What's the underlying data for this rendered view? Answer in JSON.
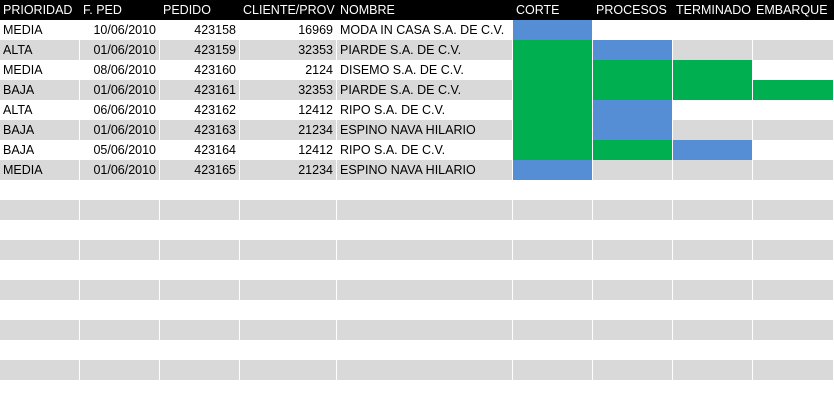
{
  "colors": {
    "header_bg": "#000000",
    "header_text": "#ffffff",
    "row_white": "#ffffff",
    "row_gray": "#d9d9d9",
    "in_progress_blue": "#558ed5",
    "done_green": "#00b050"
  },
  "headers": [
    "PRIORIDAD",
    "F. PED",
    "PEDIDO",
    "CLIENTE/PROV",
    "NOMBRE",
    "CORTE",
    "PROCESOS",
    "TERMINADO",
    "EMBARQUE"
  ],
  "orders": [
    {
      "prioridad": "MEDIA",
      "fecha": "10/06/2010",
      "pedido": "423158",
      "cliente": "16969",
      "nombre": "MODA IN CASA S.A. DE C.V.",
      "stages": [
        "blue",
        "none",
        "none",
        "none"
      ]
    },
    {
      "prioridad": "ALTA",
      "fecha": "01/06/2010",
      "pedido": "423159",
      "cliente": "32353",
      "nombre": "PIARDE S.A. DE C.V.",
      "stages": [
        "green",
        "blue",
        "none",
        "none"
      ]
    },
    {
      "prioridad": "MEDIA",
      "fecha": "08/06/2010",
      "pedido": "423160",
      "cliente": "2124",
      "nombre": "DISEMO S.A. DE C.V.",
      "stages": [
        "green",
        "green",
        "green",
        "none"
      ]
    },
    {
      "prioridad": "BAJA",
      "fecha": "01/06/2010",
      "pedido": "423161",
      "cliente": "32353",
      "nombre": "PIARDE S.A. DE C.V.",
      "stages": [
        "green",
        "green",
        "green",
        "green"
      ]
    },
    {
      "prioridad": "ALTA",
      "fecha": "06/06/2010",
      "pedido": "423162",
      "cliente": "12412",
      "nombre": "RIPO S.A. DE C.V.",
      "stages": [
        "green",
        "blue",
        "none",
        "none"
      ]
    },
    {
      "prioridad": "BAJA",
      "fecha": "01/06/2010",
      "pedido": "423163",
      "cliente": "21234",
      "nombre": "ESPINO NAVA HILARIO",
      "stages": [
        "green",
        "blue",
        "none",
        "none"
      ]
    },
    {
      "prioridad": "BAJA",
      "fecha": "05/06/2010",
      "pedido": "423164",
      "cliente": "12412",
      "nombre": "RIPO S.A. DE C.V.",
      "stages": [
        "green",
        "green",
        "blue",
        "none"
      ]
    },
    {
      "prioridad": "MEDIA",
      "fecha": "01/06/2010",
      "pedido": "423165",
      "cliente": "21234",
      "nombre": "ESPINO NAVA HILARIO",
      "stages": [
        "blue",
        "none",
        "none",
        "none"
      ]
    }
  ],
  "empty_rows": 11
}
